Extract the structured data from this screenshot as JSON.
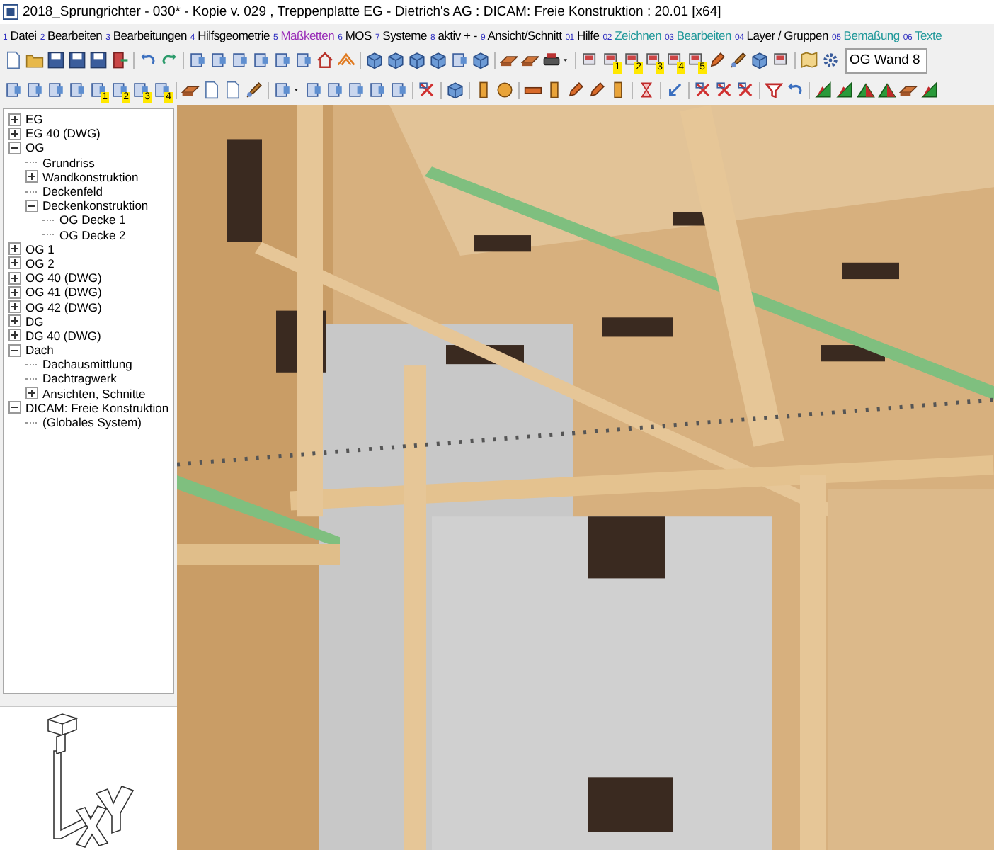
{
  "window": {
    "title": "2018_Sprungrichter - 030* - Kopie v. 029 , Treppenplatte EG - Dietrich's AG : DICAM: Freie Konstruktion : 20.01 [x64]"
  },
  "menu": [
    {
      "number": "1",
      "label": "Datei",
      "color": "#000000"
    },
    {
      "number": "2",
      "label": "Bearbeiten",
      "color": "#000000"
    },
    {
      "number": "3",
      "label": "Bearbeitungen",
      "color": "#000000"
    },
    {
      "number": "4",
      "label": "Hilfsgeometrie",
      "color": "#000000"
    },
    {
      "number": "5",
      "label": "Maßketten",
      "color": "#9a2fb8"
    },
    {
      "number": "6",
      "label": "MOS",
      "color": "#000000"
    },
    {
      "number": "7",
      "label": "Systeme",
      "color": "#000000"
    },
    {
      "number": "8",
      "label": "aktiv + -",
      "color": "#000000"
    },
    {
      "number": "9",
      "label": "Ansicht/Schnitt",
      "color": "#000000"
    },
    {
      "number": "01",
      "label": "Hilfe",
      "color": "#000000"
    },
    {
      "number": "02",
      "label": "Zeichnen",
      "color": "#22999a"
    },
    {
      "number": "03",
      "label": "Bearbeiten",
      "color": "#22999a"
    },
    {
      "number": "04",
      "label": "Layer / Gruppen",
      "color": "#000000"
    },
    {
      "number": "05",
      "label": "Bemaßung",
      "color": "#22999a"
    },
    {
      "number": "06",
      "label": "Texte",
      "color": "#22999a"
    }
  ],
  "toolbar_1": {
    "groups": [
      [
        {
          "kind": "document"
        },
        {
          "kind": "folder"
        },
        {
          "kind": "disk"
        },
        {
          "kind": "disk"
        },
        {
          "kind": "disk"
        },
        {
          "kind": "door"
        }
      ],
      [
        {
          "kind": "undo"
        },
        {
          "kind": "redo"
        }
      ],
      [
        {
          "kind": "panel"
        },
        {
          "kind": "panel"
        },
        {
          "kind": "panel"
        },
        {
          "kind": "panel"
        },
        {
          "kind": "panel"
        },
        {
          "kind": "panel"
        },
        {
          "kind": "house"
        },
        {
          "kind": "roof"
        }
      ],
      [
        {
          "kind": "cube"
        },
        {
          "kind": "cube"
        },
        {
          "kind": "cube"
        },
        {
          "kind": "cube"
        },
        {
          "kind": "panel"
        },
        {
          "kind": "cube"
        }
      ],
      [
        {
          "kind": "slab"
        },
        {
          "kind": "slab"
        },
        {
          "kind": "printer"
        },
        {
          "kind": "caret"
        }
      ],
      [
        {
          "kind": "plate"
        },
        {
          "kind": "plate",
          "badge": "1"
        },
        {
          "kind": "plate",
          "badge": "2"
        },
        {
          "kind": "plate",
          "badge": "3"
        },
        {
          "kind": "plate",
          "badge": "4"
        },
        {
          "kind": "plate",
          "badge": "5"
        },
        {
          "kind": "pencil"
        },
        {
          "kind": "brush"
        },
        {
          "kind": "cube"
        },
        {
          "kind": "plate"
        }
      ],
      [
        {
          "kind": "map"
        },
        {
          "kind": "gear"
        }
      ]
    ],
    "combo": {
      "value": "OG Wand 8"
    }
  },
  "toolbar_2": {
    "groups": [
      [
        {
          "kind": "panel"
        },
        {
          "kind": "panel"
        },
        {
          "kind": "panel"
        },
        {
          "kind": "panel"
        },
        {
          "kind": "panel",
          "badge": "1"
        },
        {
          "kind": "panel",
          "badge": "2"
        },
        {
          "kind": "panel",
          "badge": "3"
        },
        {
          "kind": "panel",
          "badge": "4"
        }
      ],
      [
        {
          "kind": "slab"
        },
        {
          "kind": "document"
        },
        {
          "kind": "document"
        },
        {
          "kind": "brush"
        }
      ],
      [
        {
          "kind": "panel"
        },
        {
          "kind": "caret"
        },
        {
          "kind": "panel"
        },
        {
          "kind": "panel"
        },
        {
          "kind": "panel"
        },
        {
          "kind": "panel"
        },
        {
          "kind": "panel"
        }
      ],
      [
        {
          "kind": "scissors"
        }
      ],
      [
        {
          "kind": "cube"
        }
      ],
      [
        {
          "kind": "post"
        },
        {
          "kind": "ball"
        }
      ],
      [
        {
          "kind": "beam"
        },
        {
          "kind": "post"
        },
        {
          "kind": "pencil"
        },
        {
          "kind": "pencil"
        },
        {
          "kind": "post"
        }
      ],
      [
        {
          "kind": "hourglass"
        }
      ],
      [
        {
          "kind": "arrow"
        }
      ],
      [
        {
          "kind": "scissors"
        },
        {
          "kind": "scissors"
        },
        {
          "kind": "scissors"
        }
      ],
      [
        {
          "kind": "funnel"
        },
        {
          "kind": "undo"
        }
      ],
      [
        {
          "kind": "flag"
        },
        {
          "kind": "flag"
        },
        {
          "kind": "triangle"
        },
        {
          "kind": "triangle"
        },
        {
          "kind": "slab"
        },
        {
          "kind": "flag"
        }
      ]
    ]
  },
  "tree": [
    {
      "label": "EG",
      "kind": "branch",
      "expanded": false
    },
    {
      "label": "EG 40 (DWG)",
      "kind": "branch",
      "expanded": false
    },
    {
      "label": "OG",
      "kind": "branch",
      "expanded": true,
      "children": [
        {
          "label": "Grundriss",
          "kind": "leaf"
        },
        {
          "label": "Wandkonstruktion",
          "kind": "branch",
          "expanded": false
        },
        {
          "label": "Deckenfeld",
          "kind": "leaf"
        },
        {
          "label": "Deckenkonstruktion",
          "kind": "branch",
          "expanded": true,
          "children": [
            {
              "label": "OG Decke 1",
              "kind": "leaf"
            },
            {
              "label": "OG Decke 2",
              "kind": "leaf"
            }
          ]
        }
      ]
    },
    {
      "label": "OG 1",
      "kind": "branch",
      "expanded": false
    },
    {
      "label": "OG 2",
      "kind": "branch",
      "expanded": false
    },
    {
      "label": "OG 40 (DWG)",
      "kind": "branch",
      "expanded": false
    },
    {
      "label": "OG 41 (DWG)",
      "kind": "branch",
      "expanded": false
    },
    {
      "label": "OG 42 (DWG)",
      "kind": "branch",
      "expanded": false
    },
    {
      "label": "DG",
      "kind": "branch",
      "expanded": false
    },
    {
      "label": "DG 40 (DWG)",
      "kind": "branch",
      "expanded": false
    },
    {
      "label": "Dach",
      "kind": "branch",
      "expanded": true,
      "children": [
        {
          "label": "Dachausmittlung",
          "kind": "leaf"
        },
        {
          "label": "Dachtragwerk",
          "kind": "leaf"
        },
        {
          "label": "Ansichten, Schnitte",
          "kind": "branch",
          "expanded": false
        }
      ]
    },
    {
      "label": "DICAM: Freie Konstruktion",
      "kind": "branch",
      "expanded": true,
      "children": [
        {
          "label": "(Globales System)",
          "kind": "leaf"
        }
      ]
    }
  ]
}
